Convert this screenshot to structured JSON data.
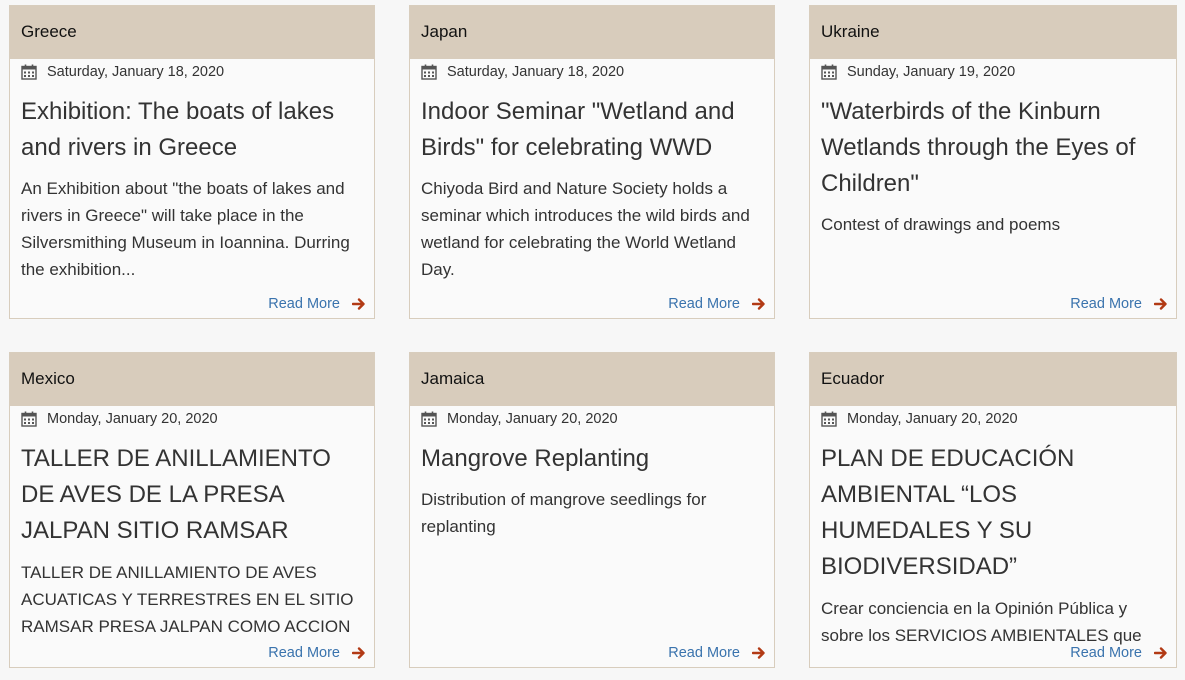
{
  "colors": {
    "header_bg": "#d8ccbc",
    "link": "#3a73ad",
    "arrow": "#b23a15"
  },
  "read_more_label": "Read More",
  "cards": [
    {
      "country": "Greece",
      "date": "Saturday, January 18, 2020",
      "title": "Exhibition: The boats of lakes and rivers in Greece",
      "description": "An Exhibition about \"the boats of lakes and rivers in Greece\" will take place in the Silversmithing Museum in Ioannina. Durring the exhibition..."
    },
    {
      "country": "Japan",
      "date": "Saturday, January 18, 2020",
      "title": "Indoor Seminar \"Wetland and Birds\" for celebrating WWD",
      "description": "Chiyoda Bird and Nature Society holds a seminar which introduces the wild birds and wetland for celebrating the World Wetland Day."
    },
    {
      "country": "Ukraine",
      "date": "Sunday, January 19, 2020",
      "title": "\"Waterbirds of the Kinburn Wetlands through the Eyes of Children\"",
      "description": "Contest of drawings and poems"
    },
    {
      "country": "Mexico",
      "date": "Monday, January 20, 2020",
      "title": "TALLER DE ANILLAMIENTO DE AVES DE LA PRESA JALPAN SITIO RAMSAR",
      "description": "TALLER DE ANILLAMIENTO DE AVES ACUATICAS Y TERRESTRES EN EL SITIO RAMSAR PRESA JALPAN COMO ACCION"
    },
    {
      "country": "Jamaica",
      "date": "Monday, January 20, 2020",
      "title": "Mangrove Replanting",
      "description": "Distribution of mangrove seedlings for replanting"
    },
    {
      "country": "Ecuador",
      "date": "Monday, January 20, 2020",
      "title": "PLAN DE EDUCACIÓN AMBIENTAL “LOS HUMEDALES Y SU BIODIVERSIDAD”",
      "description": "Crear conciencia en la Opinión Pública y sobre los SERVICIOS AMBIENTALES que"
    }
  ]
}
